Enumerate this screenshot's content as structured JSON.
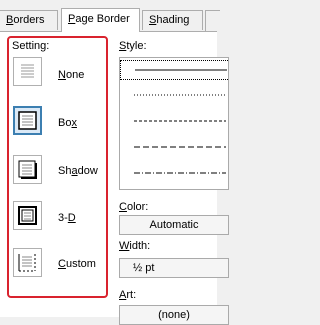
{
  "tabs": [
    {
      "label": "Borders",
      "underline_index": 0
    },
    {
      "label": "Page Border",
      "underline_index": 0
    },
    {
      "label": "Shading",
      "underline_index": 0
    }
  ],
  "active_tab": 1,
  "setting": {
    "title": "Setting:",
    "selected": "Box",
    "items": [
      {
        "label": "None",
        "icon": "none-border-icon",
        "underline_index": 0
      },
      {
        "label": "Box",
        "icon": "box-border-icon",
        "underline_index": 2
      },
      {
        "label": "Shadow",
        "icon": "shadow-border-icon",
        "underline_index": 2
      },
      {
        "label": "3-D",
        "icon": "3d-border-icon",
        "underline_index": 2
      },
      {
        "label": "Custom",
        "icon": "custom-border-icon",
        "underline_index": 0
      }
    ]
  },
  "style": {
    "title": "Style:",
    "underline_index": 0,
    "line_styles": [
      "solid",
      "dotted",
      "dashed-short",
      "dashed",
      "dash-dot"
    ]
  },
  "color": {
    "label": "Color:",
    "underline_index": 0,
    "value": "Automatic"
  },
  "width": {
    "label": "Width:",
    "underline_index": 0,
    "value": "½ pt"
  },
  "art": {
    "label": "Art:",
    "underline_index": 0,
    "value": "(none)"
  },
  "colors": {
    "highlight_border": "#d9232e",
    "selected_icon_border": "#3c7fb1",
    "selected_icon_fill": "#dbe9f6"
  }
}
